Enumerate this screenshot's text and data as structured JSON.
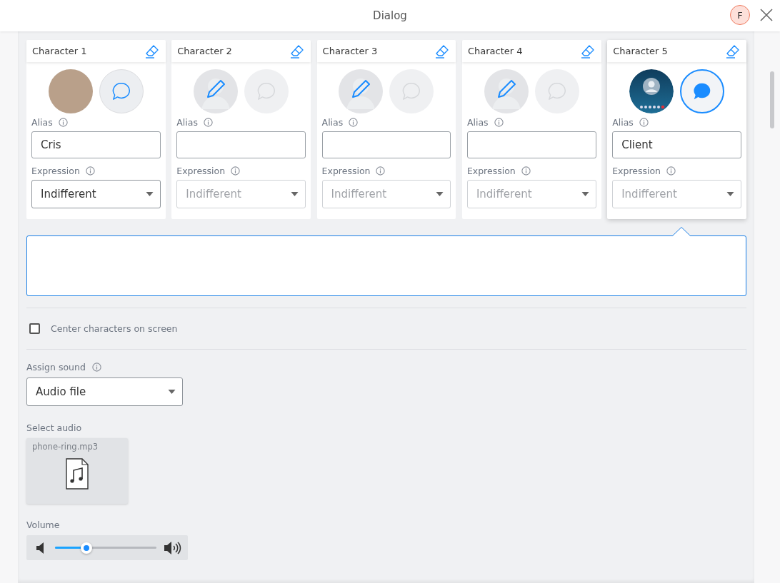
{
  "window": {
    "title": "Dialog",
    "user_initial": "F"
  },
  "characters": [
    {
      "title": "Character 1",
      "avatar": {
        "kind": "photo"
      },
      "speech_enabled": true,
      "selected": false,
      "alias_label": "Alias",
      "alias": "Cris",
      "expression_label": "Expression",
      "expression": "Indifferent",
      "expression_disabled": false
    },
    {
      "title": "Character 2",
      "avatar": {
        "kind": "empty"
      },
      "speech_enabled": false,
      "selected": false,
      "alias_label": "Alias",
      "expression_label": "Expression",
      "expression": "Indifferent",
      "expression_disabled": true
    },
    {
      "title": "Character 3",
      "avatar": {
        "kind": "empty"
      },
      "speech_enabled": false,
      "selected": false,
      "alias_label": "Alias",
      "expression_label": "Expression",
      "expression": "Indifferent",
      "expression_disabled": true
    },
    {
      "title": "Character 4",
      "avatar": {
        "kind": "empty"
      },
      "speech_enabled": false,
      "selected": false,
      "alias_label": "Alias",
      "expression_label": "Expression",
      "expression": "Indifferent",
      "expression_disabled": true
    },
    {
      "title": "Character 5",
      "avatar": {
        "kind": "video"
      },
      "speech_enabled": true,
      "selected": true,
      "alias_label": "Alias",
      "alias": "Client",
      "expression_label": "Expression",
      "expression": "Indifferent",
      "expression_disabled": true
    }
  ],
  "center_characters": {
    "label": "Center characters on screen",
    "checked": false
  },
  "assign_sound": {
    "label": "Assign sound",
    "value": "Audio file"
  },
  "select_audio": {
    "label": "Select audio",
    "file": "phone-ring.mp3"
  },
  "volume": {
    "label": "Volume",
    "level": 0.31
  }
}
